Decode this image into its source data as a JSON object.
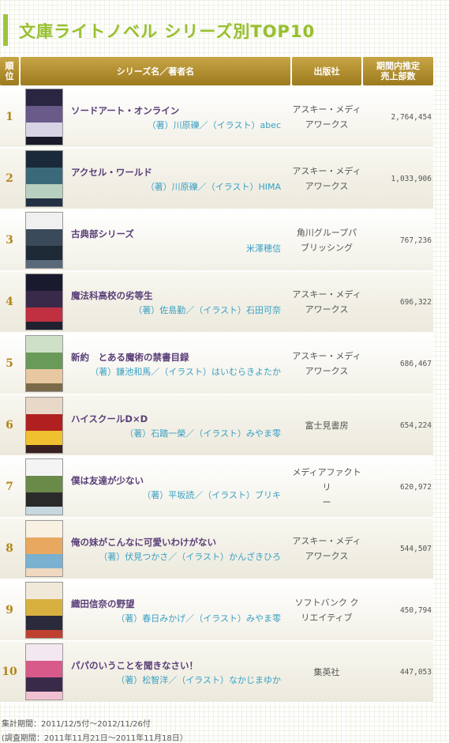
{
  "title": "文庫ライトノベル シリーズ別TOP10",
  "headers": {
    "rank": "順\n位",
    "series": "シリーズ名／著者名",
    "publisher": "出版社",
    "sales_line1": "期間内推定",
    "sales_line2": "売上部数"
  },
  "rows": [
    {
      "rank": "1",
      "title": "ソードアート・オンライン",
      "author": "（著）川原礫／（イラスト）abec",
      "publisher_l1": "アスキー・メディ",
      "publisher_l2": "アワークス",
      "sales": "2,764,454",
      "cover": [
        "#2a2540",
        "#6a5a8a",
        "#d8d4e6",
        "#1a1a2a"
      ]
    },
    {
      "rank": "2",
      "title": "アクセル・ワールド",
      "author": "（著）川原礫／（イラスト）HIMA",
      "publisher_l1": "アスキー・メディ",
      "publisher_l2": "アワークス",
      "sales": "1,033,906",
      "cover": [
        "#1b2a3a",
        "#3a6a7a",
        "#b8d0c0",
        "#223044"
      ]
    },
    {
      "rank": "3",
      "title": "古典部シリーズ",
      "author": "米澤穂信",
      "publisher_l1": "角川グループパ",
      "publisher_l2": "ブリッシング",
      "sales": "767,236",
      "cover": [
        "#f0f0f0",
        "#3a4a5a",
        "#1e2a36",
        "#5a6a7a"
      ]
    },
    {
      "rank": "4",
      "title": "魔法科高校の劣等生",
      "author": "（著）佐島勤／（イラスト）石田可奈",
      "publisher_l1": "アスキー・メディ",
      "publisher_l2": "アワークス",
      "sales": "696,322",
      "cover": [
        "#1a1a2e",
        "#3a2a4a",
        "#c03040",
        "#202030"
      ]
    },
    {
      "rank": "5",
      "title": "新約　とある魔術の禁書目録",
      "author": "（著）鎌池和馬／（イラスト）はいむらきよたか",
      "publisher_l1": "アスキー・メディ",
      "publisher_l2": "アワークス",
      "sales": "686,467",
      "cover": [
        "#cfe0c8",
        "#6a9a5a",
        "#e8c8a0",
        "#7a6a4a"
      ]
    },
    {
      "rank": "6",
      "title": "ハイスクールD×D",
      "author": "（著）石踏一榮／（イラスト）みやま零",
      "publisher_l1": "富士見書房",
      "publisher_l2": "",
      "sales": "654,224",
      "cover": [
        "#e8d8c8",
        "#b02020",
        "#f0c030",
        "#3a2020"
      ]
    },
    {
      "rank": "7",
      "title": "僕は友達が少ない",
      "author": "（著）平坂読／（イラスト）ブリキ",
      "publisher_l1": "メディアファクトリ",
      "publisher_l2": "ー",
      "sales": "620,972",
      "cover": [
        "#f4f4f4",
        "#6a8a4a",
        "#2a2a2a",
        "#c8d8e0"
      ]
    },
    {
      "rank": "8",
      "title": "俺の妹がこんなに可愛いわけがない",
      "author": "（著）伏見つかさ／（イラスト）かんざきひろ",
      "publisher_l1": "アスキー・メディ",
      "publisher_l2": "アワークス",
      "sales": "544,507",
      "cover": [
        "#f8f0e0",
        "#e8a860",
        "#7ab0d0",
        "#f0d8c0"
      ]
    },
    {
      "rank": "9",
      "title": "織田信奈の野望",
      "author": "（著）春日みかげ／（イラスト）みやま零",
      "publisher_l1": "ソフトバンク ク",
      "publisher_l2": "リエイティブ",
      "sales": "450,794",
      "cover": [
        "#f0e8d8",
        "#d8b040",
        "#2a2a3a",
        "#c04030"
      ]
    },
    {
      "rank": "10",
      "title": "パパのいうことを聞きなさい！",
      "author": "（著）松智洋／（イラスト）なかじまゆか",
      "publisher_l1": "集英社",
      "publisher_l2": "",
      "sales": "447,053",
      "cover": [
        "#f4e8f0",
        "#d85a8a",
        "#3a2a4a",
        "#f0c0d0"
      ]
    }
  ],
  "footer": {
    "period": "集計期間：2011/12/5付〜2012/11/26付",
    "survey": "(調査期間：2011年11月21日〜2011年11月18日）"
  }
}
